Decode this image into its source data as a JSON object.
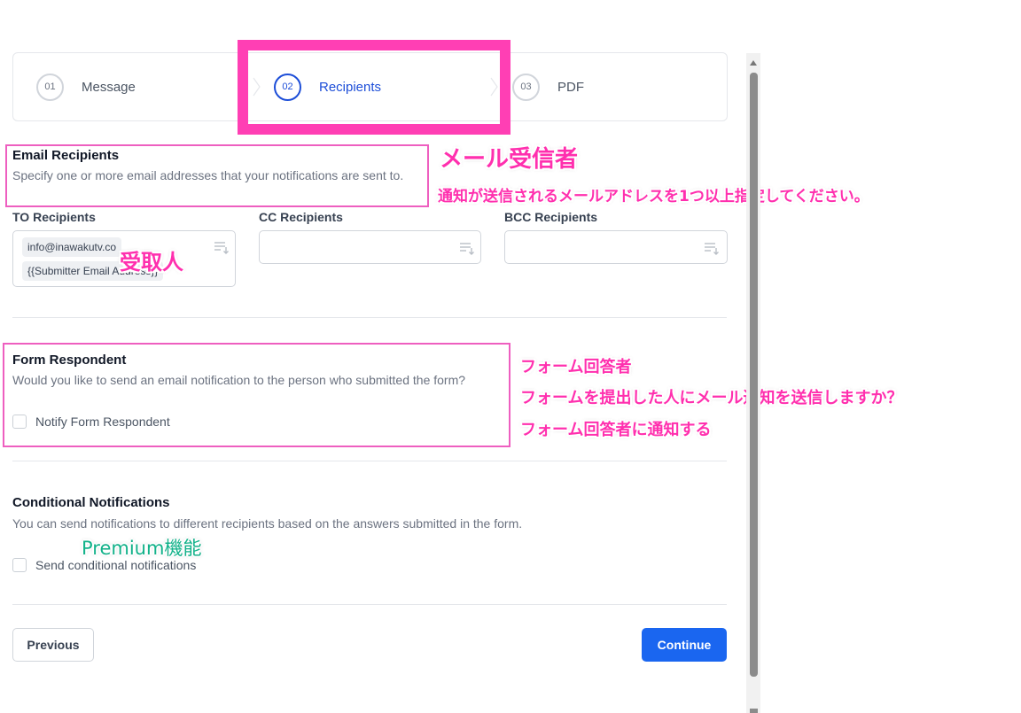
{
  "stepper": {
    "steps": [
      {
        "number": "01",
        "label": "Message",
        "active": false
      },
      {
        "number": "02",
        "label": "Recipients",
        "active": true
      },
      {
        "number": "03",
        "label": "PDF",
        "active": false
      }
    ]
  },
  "email_recipients": {
    "title": "Email Recipients",
    "description": "Specify one or more email addresses that your notifications are sent to.",
    "to_label": "TO Recipients",
    "cc_label": "CC Recipients",
    "bcc_label": "BCC Recipients",
    "to_chips": [
      "info@inawakutv.co",
      "{{Submitter Email Address}}"
    ]
  },
  "form_respondent": {
    "title": "Form Respondent",
    "description": "Would you like to send an email notification to the person who submitted the form?",
    "checkbox_label": "Notify Form Respondent",
    "checked": false
  },
  "conditional": {
    "title": "Conditional Notifications",
    "description": "You can send notifications to different recipients based on the answers submitted in the form.",
    "checkbox_label": "Send conditional notifications",
    "checked": false
  },
  "buttons": {
    "previous": "Previous",
    "continue": "Continue"
  },
  "annotations": {
    "email_title_jp": "メール受信者",
    "email_desc_jp": "通知が送信されるメールアドレスを1つ以上指定してください。",
    "to_jp": "受取人",
    "respondent_title_jp": "フォーム回答者",
    "respondent_desc_jp": "フォームを提出した人にメール通知を送信しますか？",
    "respondent_check_jp": "フォーム回答者に通知する",
    "premium_jp": "Premium機能"
  },
  "colors": {
    "accent": "#1a66f0",
    "annotation_pink": "#ff3fb4",
    "annotation_green": "#12b28a"
  },
  "icons": [
    "chevron-right-icon",
    "list-sort-icon",
    "scroll-up-icon"
  ]
}
